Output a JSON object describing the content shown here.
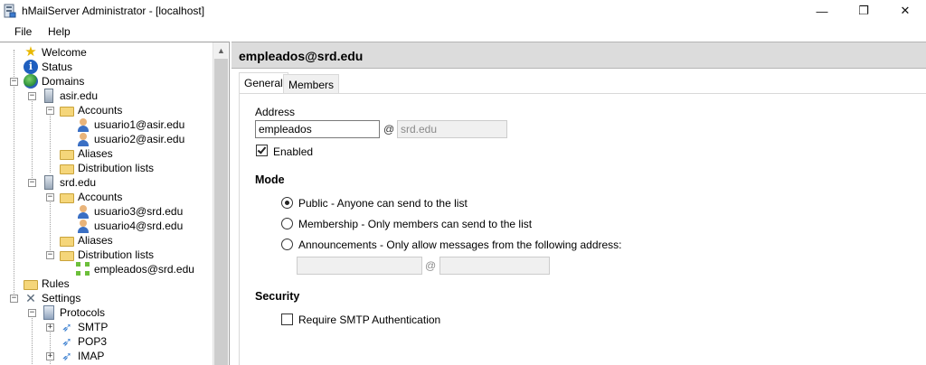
{
  "window": {
    "title": "hMailServer Administrator - [localhost]",
    "minimize_glyph": "—",
    "maximize_glyph": "❐",
    "close_glyph": "✕"
  },
  "menu": {
    "file": "File",
    "help": "Help"
  },
  "tree": {
    "scroll_up_glyph": "▲",
    "welcome": "Welcome",
    "status": "Status",
    "domains": "Domains",
    "domain1": "asir.edu",
    "domain1_accounts": "Accounts",
    "domain1_account1": "usuario1@asir.edu",
    "domain1_account2": "usuario2@asir.edu",
    "domain1_aliases": "Aliases",
    "domain1_distlists": "Distribution lists",
    "domain2": "srd.edu",
    "domain2_accounts": "Accounts",
    "domain2_account1": "usuario3@srd.edu",
    "domain2_account2": "usuario4@srd.edu",
    "domain2_aliases": "Aliases",
    "domain2_distlists": "Distribution lists",
    "domain2_list1": "empleados@srd.edu",
    "rules": "Rules",
    "settings": "Settings",
    "protocols": "Protocols",
    "smtp": "SMTP",
    "pop3": "POP3",
    "imap": "IMAP"
  },
  "header": {
    "title": "empleados@srd.edu"
  },
  "tabs": {
    "general": "General",
    "members": "Members"
  },
  "general": {
    "address_label": "Address",
    "address_value": "empleados",
    "at_sign": "@",
    "domain_value": "srd.edu",
    "enabled_label": "Enabled",
    "enabled_checked": true,
    "mode_heading": "Mode",
    "mode_public": "Public - Anyone can send to the list",
    "mode_membership": "Membership - Only members can send to the list",
    "mode_announcements": "Announcements - Only allow messages from the following address:",
    "mode_selected": "public",
    "announce_user_value": "",
    "announce_domain_value": "",
    "security_heading": "Security",
    "require_smtp_auth_label": "Require SMTP Authentication",
    "require_smtp_auth_checked": false
  }
}
